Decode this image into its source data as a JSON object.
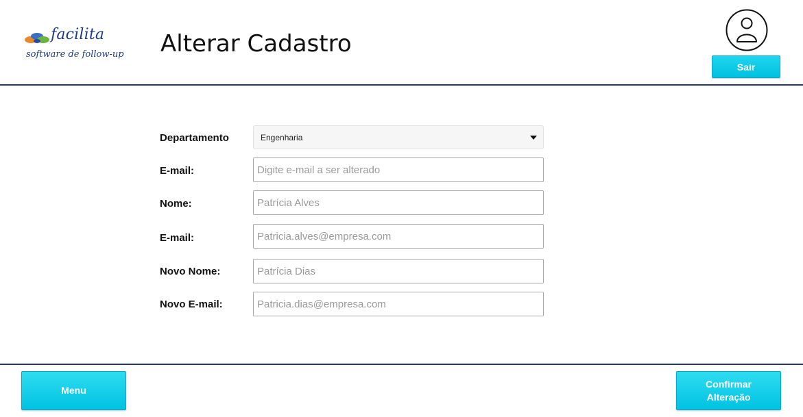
{
  "header": {
    "logo_name": "facilita",
    "logo_tagline": "software de follow-up",
    "title": "Alterar Cadastro",
    "avatar_icon": "user-icon",
    "logout_label": "Sair"
  },
  "form": {
    "department": {
      "label": "Departamento",
      "value": "Engenharia"
    },
    "email_search": {
      "label": "E-mail:",
      "placeholder": "Digite e-mail a ser alterado"
    },
    "name": {
      "label": "Nome:",
      "placeholder": "Patrícia Alves"
    },
    "email": {
      "label": "E-mail:",
      "placeholder": "Patricia.alves@empresa.com"
    },
    "new_name": {
      "label": "Novo Nome:",
      "placeholder": "Patrícia Dias"
    },
    "new_email": {
      "label": "Novo E-mail:",
      "placeholder": "Patricia.dias@empresa.com"
    }
  },
  "footer": {
    "menu_label": "Menu",
    "confirm_line1": "Confirmar",
    "confirm_line2": "Alteração"
  },
  "colors": {
    "accent": "#00c8e6",
    "rule": "#24356f",
    "logo_text": "#1d3b83"
  }
}
